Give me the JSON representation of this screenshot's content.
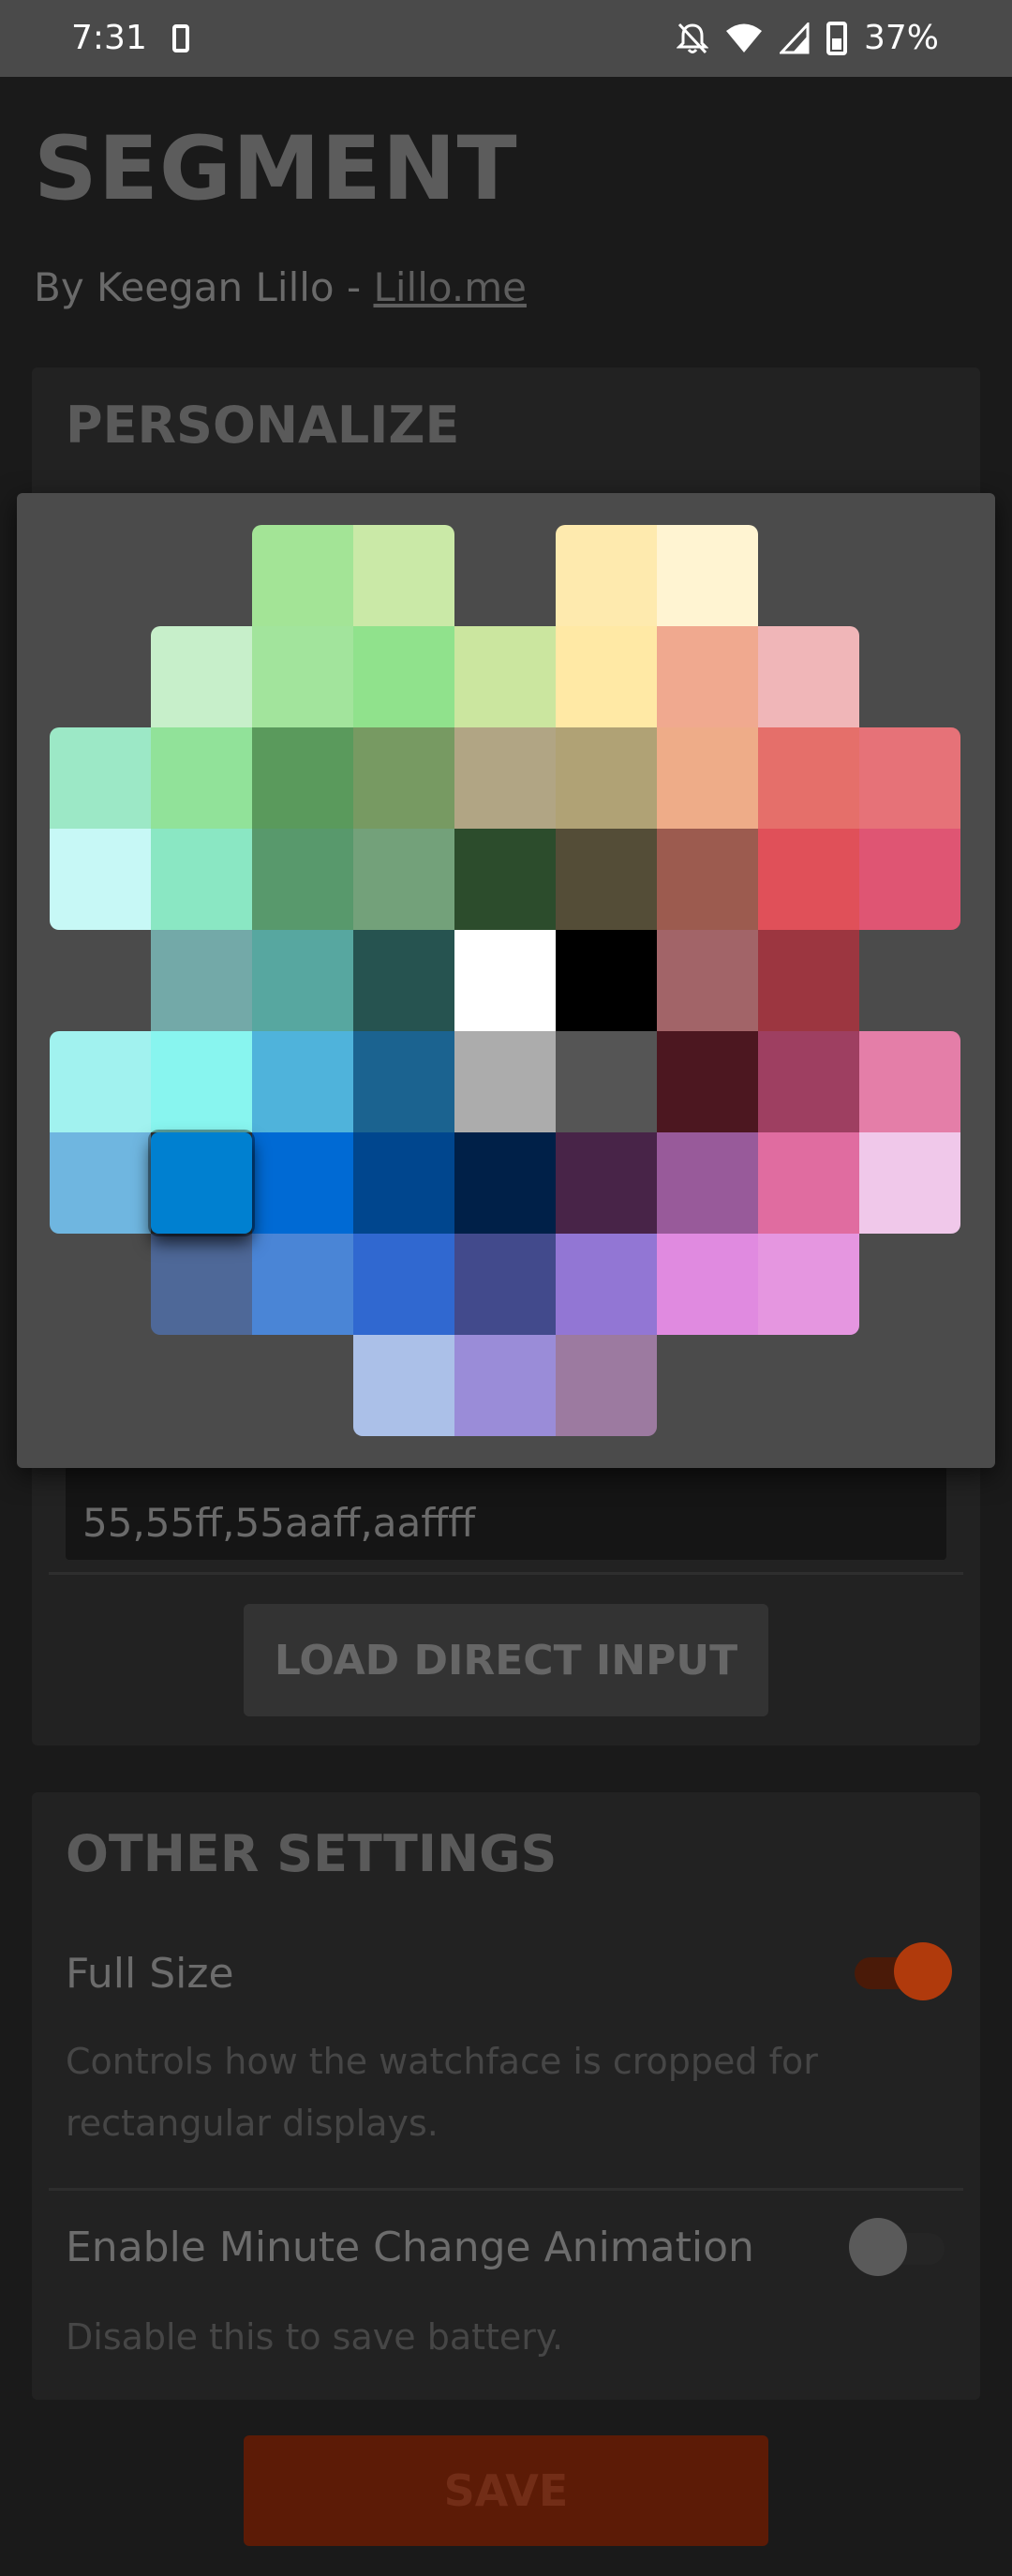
{
  "status": {
    "time": "7:31",
    "battery": "37%"
  },
  "app": {
    "title": "SEGMENT",
    "byline_prefix": "By Keegan Lillo - ",
    "byline_link": "Lillo.me"
  },
  "personalize": {
    "title": "PERSONALIZE",
    "direct_input_value": "55,55ff,55aaff,aaffff",
    "load_button": "LOAD DIRECT INPUT"
  },
  "other": {
    "title": "OTHER SETTINGS",
    "full_size": {
      "label": "Full Size",
      "desc": "Controls how the watchface is cropped for rectangular displays.",
      "enabled": true
    },
    "minute_anim": {
      "label": "Enable Minute Change Animation",
      "desc": "Disable this to save battery.",
      "enabled": false
    }
  },
  "save_button": "SAVE",
  "colors": {
    "accent": "#b03a0c",
    "accent_thumb": "#c24010",
    "save_bg": "#5c1b06"
  },
  "picker_rows": [
    [
      "",
      "",
      "#a3e496",
      "#cae9a7",
      "",
      "#feeaae",
      "#fff4d2",
      "",
      ""
    ],
    [
      "",
      "#c7efca",
      "#a2e49c",
      "#90e28c",
      "#cbe69f",
      "#ffe9a5",
      "#f0a98f",
      "#f0b6b8",
      ""
    ],
    [
      "#9ce8c6",
      "#91e299",
      "#5a9a5c",
      "#779a62",
      "#b1a584",
      "#b0a275",
      "#eeac88",
      "#e56f6a",
      "#e67278"
    ],
    [
      "#c7f8f6",
      "#8ae7c3",
      "#58996c",
      "#73a17a",
      "#2c4c2c",
      "#544d37",
      "#9c5b4f",
      "#e05059",
      "#df5573"
    ],
    [
      "",
      "#73a9a8",
      "#57a7a0",
      "#265350",
      "#ffffff",
      "#000000",
      "#a26468",
      "#9c3640",
      ""
    ],
    [
      "#a1f2ef",
      "#88f5ef",
      "#4fb3db",
      "#1b6390",
      "#acacac",
      "#555555",
      "#4c1720",
      "#9e3f61",
      "#e47ea8"
    ],
    [
      "#6fb6e0",
      "#0080d0",
      "#006ad4",
      "#00468e",
      "#002048",
      "#482448",
      "#985a9a",
      "#e06ca0",
      "#f0c8ea"
    ],
    [
      "",
      "#4e6898",
      "#4a85d6",
      "#3068d0",
      "#424a8c",
      "#9276d4",
      "#e08ae0",
      "#e596e0",
      ""
    ],
    [
      "",
      "",
      "",
      "#abc0e8",
      "#9a8cd8",
      "#9c7aa0",
      "",
      "",
      ""
    ]
  ]
}
